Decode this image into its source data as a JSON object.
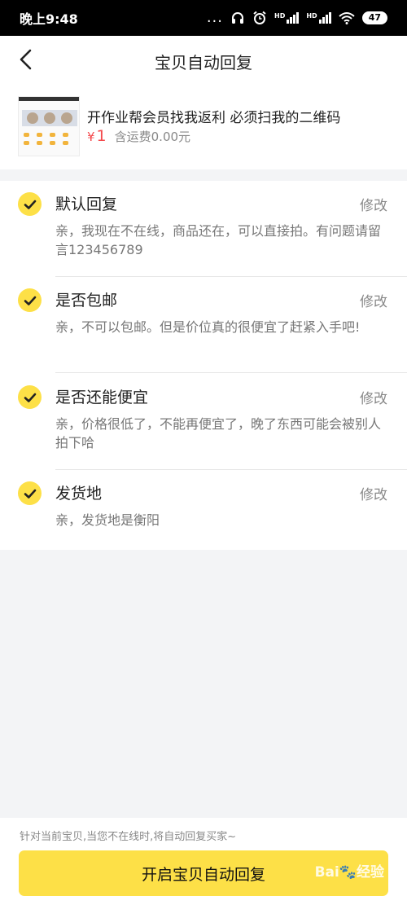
{
  "status_bar": {
    "time": "晚上9:48",
    "dots": "...",
    "hd1": "HD",
    "hd2": "HD",
    "battery": "47",
    "icons": [
      "headset-icon",
      "alarm-icon",
      "signal-icon",
      "wifi-icon",
      "battery-icon"
    ]
  },
  "nav": {
    "title": "宝贝自动回复",
    "back_icon": "chevron-left-icon"
  },
  "product": {
    "title": "开作业帮会员找我返利  必须扫我的二维码",
    "currency": "¥",
    "price": "1",
    "shipping": "含运费0.00元"
  },
  "replies": [
    {
      "title": "默认回复",
      "edit": "修改",
      "body": "亲，我现在不在线，商品还在，可以直接拍。有问题请留言123456789"
    },
    {
      "title": "是否包邮",
      "edit": "修改",
      "body": "亲，不可以包邮。但是价位真的很便宜了赶紧入手吧!"
    },
    {
      "title": "是否还能便宜",
      "edit": "修改",
      "body": "亲，价格很低了，不能再便宜了，晚了东西可能会被别人拍下哈"
    },
    {
      "title": "发货地",
      "edit": "修改",
      "body": "亲，发货地是衡阳"
    }
  ],
  "bottom": {
    "hint": "针对当前宝贝,当您不在线时,将自动回复买家~",
    "button": "开启宝贝自动回复",
    "watermark": "Bai🐾经验"
  },
  "colors": {
    "accent": "#fde047",
    "price": "#f4494c",
    "muted": "#888888",
    "background": "#f3f4f6"
  }
}
